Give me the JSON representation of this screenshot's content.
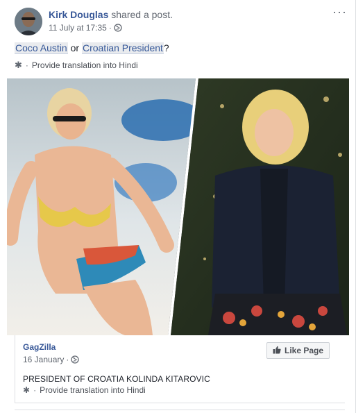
{
  "post": {
    "author": "Kirk Douglas",
    "action": "shared a post.",
    "timestamp": "11 July at 17:35",
    "privacy_icon": "globe-icon",
    "text": {
      "tag1": "Coco Austin",
      "connector": " or ",
      "tag2": "Croatian President",
      "tail": "?"
    },
    "translate": {
      "dot": "·",
      "link": "Provide translation into Hindi"
    },
    "more_icon": "···"
  },
  "shared_post": {
    "page_name": "GagZilla",
    "timestamp": "16 January",
    "separator": "·",
    "text": "PRESIDENT OF CROATIA KOLINDA KITAROVIC",
    "translate": {
      "dot": "·",
      "link": "Provide translation into Hindi"
    },
    "like_page_label": "Like Page"
  },
  "colors": {
    "link": "#385898",
    "muted": "#616770",
    "background": "#ffffff"
  }
}
